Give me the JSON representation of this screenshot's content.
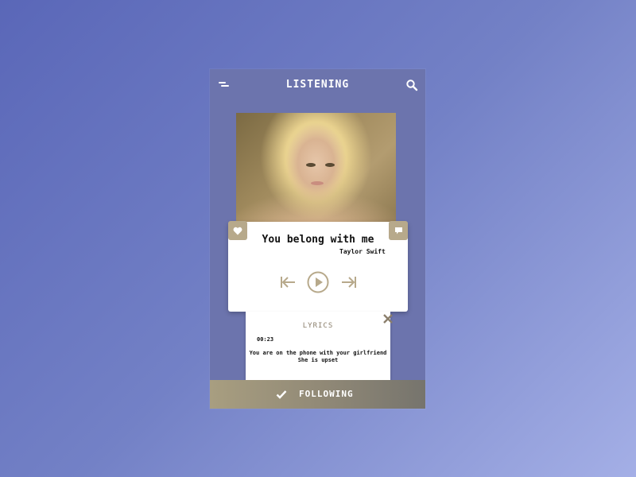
{
  "header": {
    "title": "LISTENING",
    "menu_icon": "menu-icon",
    "search_icon": "search-icon"
  },
  "now_playing": {
    "song_title": "You belong with me",
    "artist": "Taylor Swift",
    "like_icon": "heart-icon",
    "comment_icon": "comment-icon",
    "controls": {
      "prev_icon": "skip-back-icon",
      "play_icon": "play-icon",
      "next_icon": "skip-forward-icon"
    }
  },
  "lyrics": {
    "title": "LYRICS",
    "timestamp": "00:23",
    "lines": [
      "You are on the phone with your girlfriend",
      "She is upset"
    ],
    "close_icon": "close-icon"
  },
  "footer": {
    "label": "FOLLOWING",
    "check_icon": "check-icon"
  },
  "colors": {
    "accent": "#b7a98b",
    "phone_bg": "#6c74ad",
    "card_bg": "#ffffff"
  }
}
